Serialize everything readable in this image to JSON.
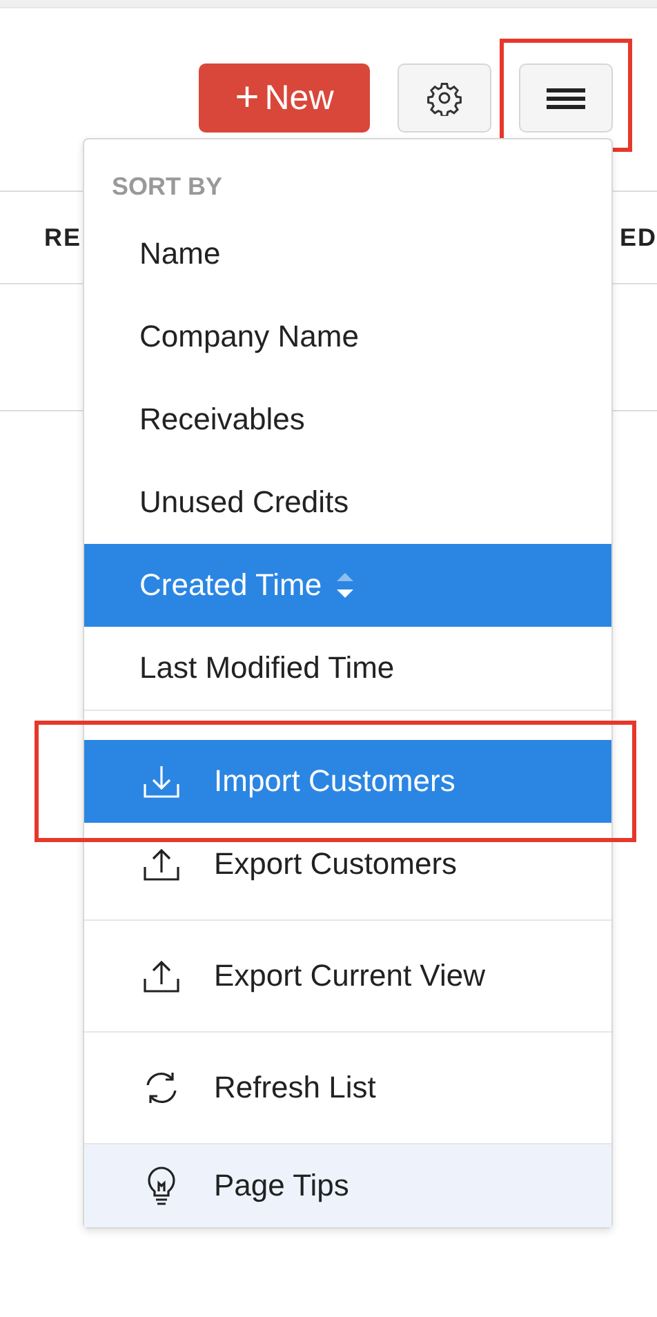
{
  "toolbar": {
    "new_button": {
      "icon": "+",
      "label": "New"
    },
    "menu_button": {
      "highlighted": true
    }
  },
  "table": {
    "columns": [
      {
        "label": "RE"
      },
      {
        "label": "ED"
      }
    ]
  },
  "menu": {
    "section_title": "SORT BY",
    "sort_options": [
      {
        "label": "Name",
        "selected": false
      },
      {
        "label": "Company Name",
        "selected": false
      },
      {
        "label": "Receivables",
        "selected": false
      },
      {
        "label": "Unused Credits",
        "selected": false
      },
      {
        "label": "Created Time",
        "selected": true
      },
      {
        "label": "Last Modified Time",
        "selected": false
      }
    ],
    "action_groups": [
      [
        {
          "label": "Import Customers",
          "selected": true,
          "highlighted": true,
          "kind": "import"
        },
        {
          "label": "Export Customers",
          "selected": false,
          "highlighted": false,
          "kind": "export"
        }
      ],
      [
        {
          "label": "Export Current View",
          "selected": false,
          "highlighted": false,
          "kind": "export"
        }
      ],
      [
        {
          "label": "Refresh List",
          "selected": false,
          "highlighted": false,
          "kind": "refresh"
        }
      ],
      [
        {
          "label": "Page Tips",
          "selected": false,
          "highlighted": false,
          "kind": "tip"
        }
      ]
    ]
  }
}
